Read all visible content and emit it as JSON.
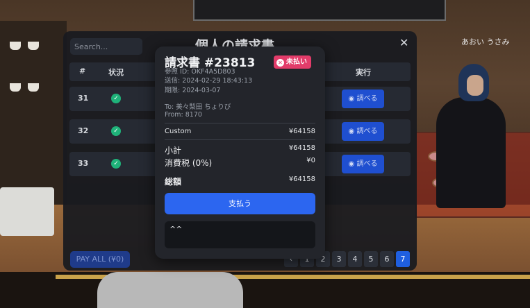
{
  "scene": {
    "npc_name": "あおい うさみ"
  },
  "panel": {
    "title": "個人の請求書",
    "search_placeholder": "Search...",
    "close_label": "✕",
    "columns": {
      "num": "#",
      "status": "状況",
      "action": "実行"
    },
    "rows": [
      {
        "num": "31",
        "status_icon": "check-circle-icon",
        "action_label": "◉ 調べる"
      },
      {
        "num": "32",
        "status_icon": "check-circle-icon",
        "action_label": "◉ 調べる"
      },
      {
        "num": "33",
        "status_icon": "check-circle-icon",
        "action_label": "◉ 調べる"
      }
    ],
    "pay_all_label": "PAY ALL (¥0)",
    "pagination": {
      "prev": "‹",
      "pages": [
        "1",
        "2",
        "3",
        "4",
        "5",
        "6",
        "7"
      ],
      "current": "7"
    }
  },
  "invoice": {
    "title": "請求書 #23813",
    "status_badge": "未払い",
    "reference": "参照 ID: OKF4A5D803",
    "sent": "送信: 2024-02-29 18:43:13",
    "due": "期限: 2024-03-07",
    "to": "To: 美々梨田 ちょりび",
    "from": "From: 8170",
    "items": [
      {
        "label": "Custom",
        "amount": "¥64158"
      }
    ],
    "subtotal_label": "小計",
    "subtotal": "¥64158",
    "tax_label": "消費税 (0%)",
    "tax": "¥0",
    "total_label": "総額",
    "total": "¥64158",
    "pay_button": "支払う",
    "note": "^^"
  },
  "colors": {
    "accent": "#2c66f0",
    "unpaid_badge": "#e23c6a",
    "success": "#1fb37a"
  }
}
